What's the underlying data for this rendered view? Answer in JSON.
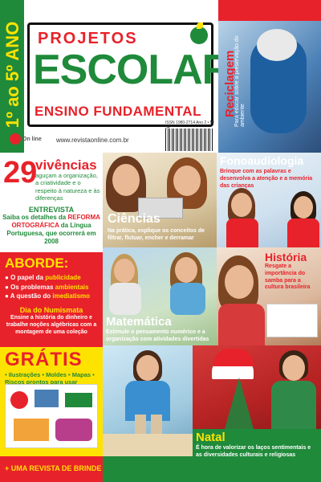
{
  "header": {
    "grade": "1º ao 5º ANO",
    "logo_top": "PROJETOS",
    "logo_main": "ESCOLARES",
    "logo_sub": "ENSINO FUNDAMENTAL",
    "site_url": "www.revistaonline.com.br",
    "publisher": "On line",
    "issn": "ISSN 1980-2714 Ano 2 • Nº 34"
  },
  "reciclagem": {
    "title": "Reciclagem",
    "desc": "Para educar sobre a preservação do ambiente"
  },
  "vivencias": {
    "number": "29",
    "title": "vivências",
    "desc": "aguçam a organização, a criatividade e o respeito à natureza e às diferenças"
  },
  "entrevista": {
    "label": "ENTREVISTA",
    "desc_1": "Saiba os detalhes da",
    "highlight": "REFORMA ORTOGRÁFICA",
    "desc_2": "da Língua Portuguesa, que ocorrerá em 2008"
  },
  "aborde": {
    "title": "ABORDE:",
    "items": [
      {
        "prefix": "O papel da ",
        "bold": "publicidade"
      },
      {
        "prefix": "Os problemas ",
        "bold": "ambientais"
      },
      {
        "prefix": "A questão do ",
        "bold": "imediatismo"
      }
    ],
    "numis_title": "Dia do Numismata",
    "numis_desc": "Ensine a história do dinheiro e trabalhe noções algébricas com a montagem de uma coleção"
  },
  "gratis": {
    "title": "GRÁTIS",
    "desc": "• Ilustrações • Moldes • Mapas • Riscos prontos para usar",
    "brinde": "+ UMA REVISTA DE BRINDE"
  },
  "ciencias": {
    "title": "Ciências",
    "desc": "Na prática, explique os conceitos de filtrar, flutuar, encher e derramar"
  },
  "fono": {
    "title": "Fonoaudiologia",
    "desc": "Brinque com as palavras e desenvolva a atenção e a memória das crianças"
  },
  "matematica": {
    "title": "Matemática",
    "desc": "Estimule o pensamento numérico e a organização com atividades divertidas"
  },
  "historia": {
    "title": "História",
    "desc": "Resgate a importância do samba para a cultura brasileira"
  },
  "natal": {
    "title": "Natal",
    "desc": "É hora de valorizar os laços sentimentais e as diversidades culturais e religiosas"
  },
  "colors": {
    "red": "#e8222a",
    "green": "#1f8a3a",
    "yellow": "#ffe300"
  }
}
